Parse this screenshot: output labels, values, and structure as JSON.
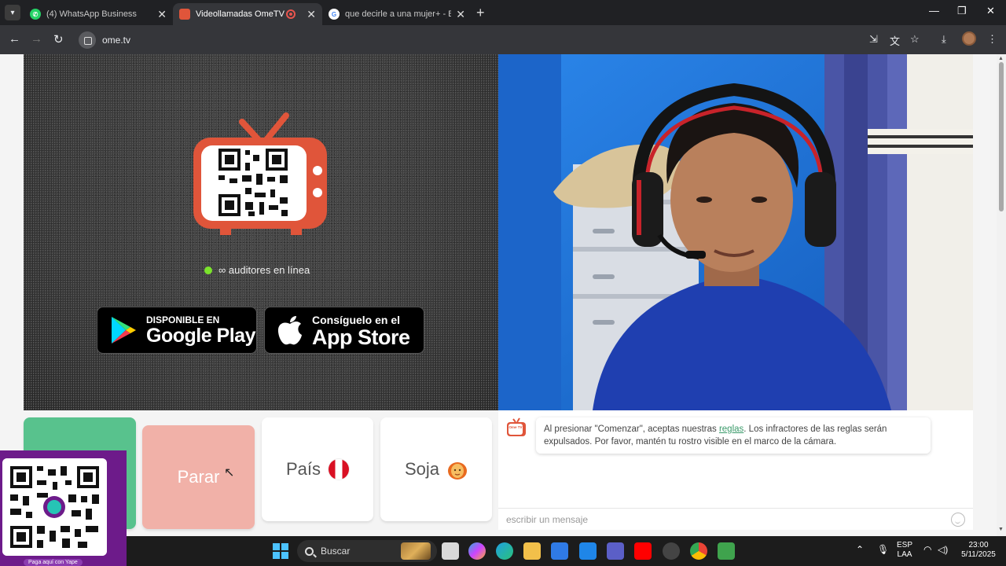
{
  "browser": {
    "tabs": [
      {
        "title": "(4) WhatsApp Business",
        "favicon": "whatsapp-icon",
        "active": false
      },
      {
        "title": "Videollamadas OmeTV — A",
        "favicon": "ometv-icon",
        "active": true,
        "recording": true
      },
      {
        "title": "que decirle a una mujer+ - Busc",
        "favicon": "google-icon",
        "active": false
      }
    ],
    "url": "ome.tv"
  },
  "hero": {
    "online_text": "∞ auditores en línea",
    "google_play_small": "DISPONIBLE EN",
    "google_play_big": "Google Play",
    "app_store_small": "Consíguelo en el",
    "app_store_big": "App Store"
  },
  "controls": {
    "start_label": "",
    "stop_label": "Parar",
    "country_label": "País",
    "gender_label": "Soja"
  },
  "chat": {
    "logo_text": "Ome TV",
    "message_before": "Al presionar \"Comenzar\", aceptas nuestras",
    "message_link": "reglas",
    "message_after": ". Los infractores de las reglas serán expulsados. Por favor, mantén tu rostro visible en el marco de la cámara.",
    "input_placeholder": "escribir un mensaje"
  },
  "yape": {
    "caption": "Paga aquí con Yape"
  },
  "taskbar": {
    "search_label": "Buscar",
    "lang_line1": "ESP",
    "lang_line2": "LAA",
    "time": "23:00",
    "date": "5/11/2025"
  },
  "colors": {
    "start_green": "#58c28d",
    "stop_pink": "#f1b1a8",
    "ometv_orange": "#e0553a",
    "online_green": "#7be32c"
  }
}
